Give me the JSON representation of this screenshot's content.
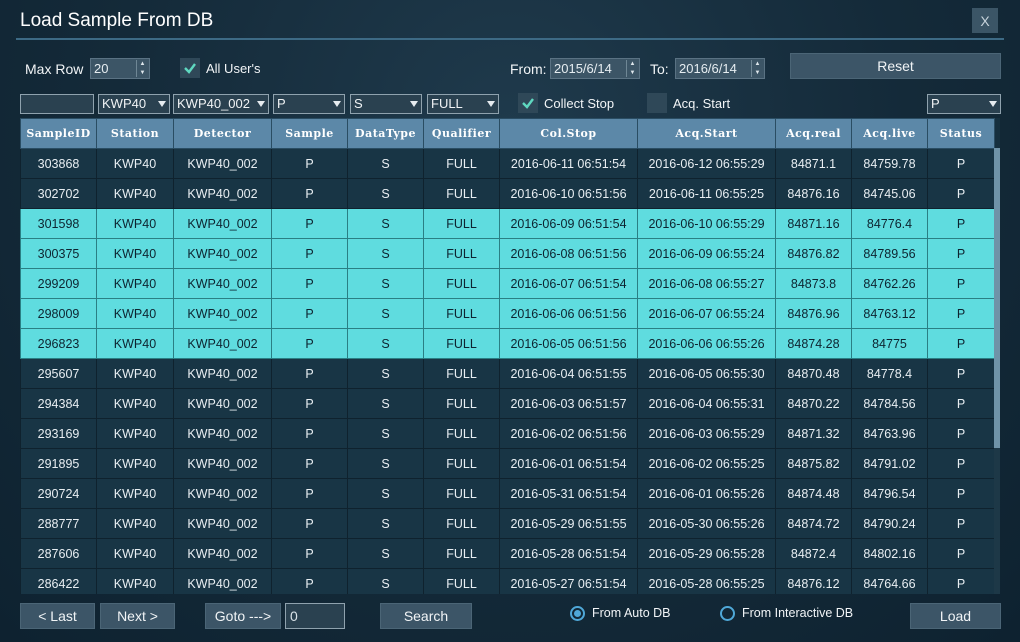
{
  "title": "Load Sample From DB",
  "close_label": "X",
  "max_row": {
    "label": "Max Row",
    "value": "20"
  },
  "all_users": {
    "label": "All User's",
    "checked": true
  },
  "from": {
    "label": "From:",
    "value": "2015/6/14"
  },
  "to": {
    "label": "To:",
    "value": "2016/6/14"
  },
  "reset_label": "Reset",
  "filters": {
    "sample_id": "",
    "station": "KWP40",
    "detector": "KWP40_002",
    "sample": "P",
    "datatype": "S",
    "qualifier": "FULL",
    "status": "P"
  },
  "collect_stop": {
    "label": "Collect Stop",
    "checked": true
  },
  "acq_start": {
    "label": "Acq. Start",
    "checked": false
  },
  "columns": [
    "SampleID",
    "Station",
    "Detector",
    "Sample",
    "DataType",
    "Qualifier",
    "Col.Stop",
    "Acq.Start",
    "Acq.real",
    "Acq.live",
    "Status"
  ],
  "rows": [
    [
      "303868",
      "KWP40",
      "KWP40_002",
      "P",
      "S",
      "FULL",
      "2016-06-11 06:51:54",
      "2016-06-12 06:55:29",
      "84871.1",
      "84759.78",
      "P"
    ],
    [
      "302702",
      "KWP40",
      "KWP40_002",
      "P",
      "S",
      "FULL",
      "2016-06-10 06:51:56",
      "2016-06-11 06:55:25",
      "84876.16",
      "84745.06",
      "P"
    ],
    [
      "301598",
      "KWP40",
      "KWP40_002",
      "P",
      "S",
      "FULL",
      "2016-06-09 06:51:54",
      "2016-06-10 06:55:29",
      "84871.16",
      "84776.4",
      "P"
    ],
    [
      "300375",
      "KWP40",
      "KWP40_002",
      "P",
      "S",
      "FULL",
      "2016-06-08 06:51:56",
      "2016-06-09 06:55:24",
      "84876.82",
      "84789.56",
      "P"
    ],
    [
      "299209",
      "KWP40",
      "KWP40_002",
      "P",
      "S",
      "FULL",
      "2016-06-07 06:51:54",
      "2016-06-08 06:55:27",
      "84873.8",
      "84762.26",
      "P"
    ],
    [
      "298009",
      "KWP40",
      "KWP40_002",
      "P",
      "S",
      "FULL",
      "2016-06-06 06:51:56",
      "2016-06-07 06:55:24",
      "84876.96",
      "84763.12",
      "P"
    ],
    [
      "296823",
      "KWP40",
      "KWP40_002",
      "P",
      "S",
      "FULL",
      "2016-06-05 06:51:56",
      "2016-06-06 06:55:26",
      "84874.28",
      "84775",
      "P"
    ],
    [
      "295607",
      "KWP40",
      "KWP40_002",
      "P",
      "S",
      "FULL",
      "2016-06-04 06:51:55",
      "2016-06-05 06:55:30",
      "84870.48",
      "84778.4",
      "P"
    ],
    [
      "294384",
      "KWP40",
      "KWP40_002",
      "P",
      "S",
      "FULL",
      "2016-06-03 06:51:57",
      "2016-06-04 06:55:31",
      "84870.22",
      "84784.56",
      "P"
    ],
    [
      "293169",
      "KWP40",
      "KWP40_002",
      "P",
      "S",
      "FULL",
      "2016-06-02 06:51:56",
      "2016-06-03 06:55:29",
      "84871.32",
      "84763.96",
      "P"
    ],
    [
      "291895",
      "KWP40",
      "KWP40_002",
      "P",
      "S",
      "FULL",
      "2016-06-01 06:51:54",
      "2016-06-02 06:55:25",
      "84875.82",
      "84791.02",
      "P"
    ],
    [
      "290724",
      "KWP40",
      "KWP40_002",
      "P",
      "S",
      "FULL",
      "2016-05-31 06:51:54",
      "2016-06-01 06:55:26",
      "84874.48",
      "84796.54",
      "P"
    ],
    [
      "288777",
      "KWP40",
      "KWP40_002",
      "P",
      "S",
      "FULL",
      "2016-05-29 06:51:55",
      "2016-05-30 06:55:26",
      "84874.72",
      "84790.24",
      "P"
    ],
    [
      "287606",
      "KWP40",
      "KWP40_002",
      "P",
      "S",
      "FULL",
      "2016-05-28 06:51:54",
      "2016-05-29 06:55:28",
      "84872.4",
      "84802.16",
      "P"
    ],
    [
      "286422",
      "KWP40",
      "KWP40_002",
      "P",
      "S",
      "FULL",
      "2016-05-27 06:51:54",
      "2016-05-28 06:55:25",
      "84876.12",
      "84764.66",
      "P"
    ]
  ],
  "highlighted_rows": [
    2,
    3,
    4,
    5,
    6
  ],
  "nav": {
    "last_label": "< Last",
    "next_label": "Next >",
    "goto_label": "Goto --->",
    "goto_value": "0",
    "search_label": "Search",
    "load_label": "Load"
  },
  "source": {
    "auto_label": "From Auto DB",
    "interactive_label": "From Interactive DB",
    "selected": "auto"
  },
  "colors": {
    "highlight": "#5fdcdf",
    "header": "#5c88a8",
    "accent": "#4fa8d8"
  }
}
